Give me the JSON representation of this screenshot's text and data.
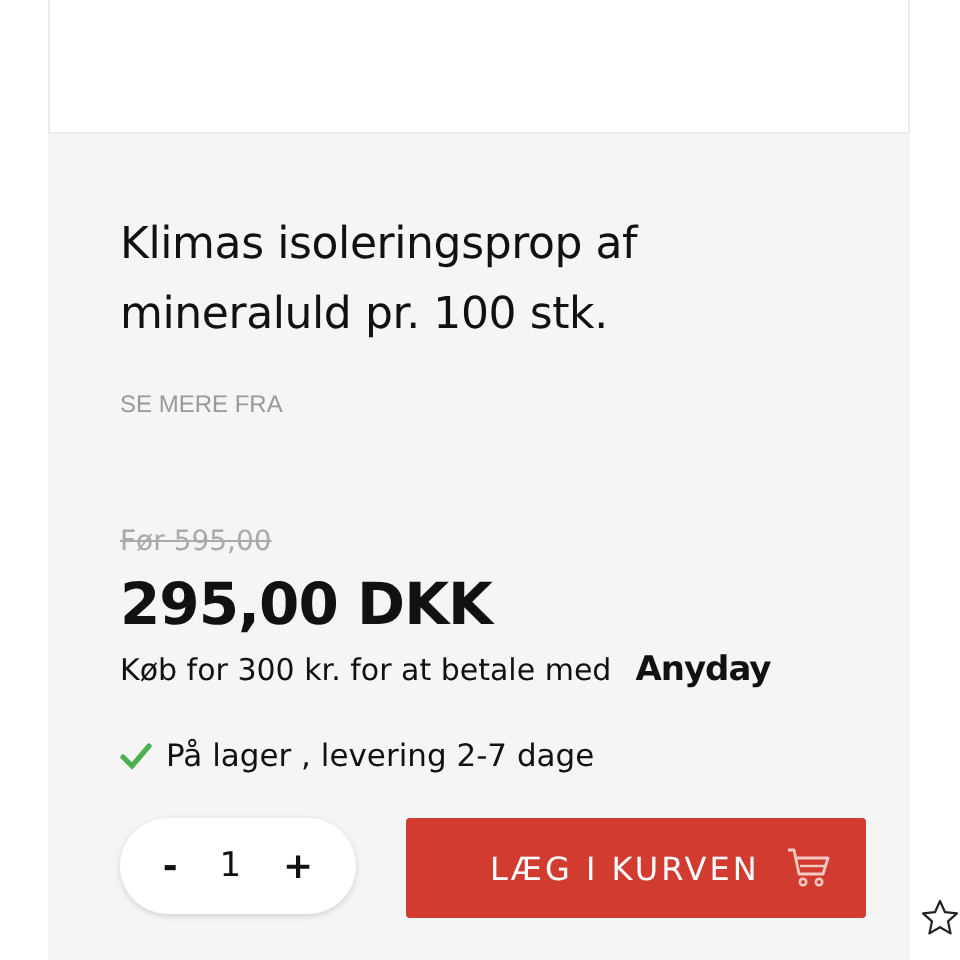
{
  "product": {
    "title": "Klimas isoleringsprop af mineraluld pr. 100 stk.",
    "see_more": "SE MERE FRA",
    "old_price": "Før 595,00",
    "price": "295,00 DKK",
    "financing": {
      "text": "Køb for 300 kr. for at betale med",
      "provider": "Anyday"
    },
    "stock": {
      "in_stock": true,
      "text": "På lager , levering 2-7 dage"
    }
  },
  "purchase": {
    "minus": "-",
    "quantity": "1",
    "plus": "+",
    "add_to_cart": "LÆG I KURVEN"
  }
}
